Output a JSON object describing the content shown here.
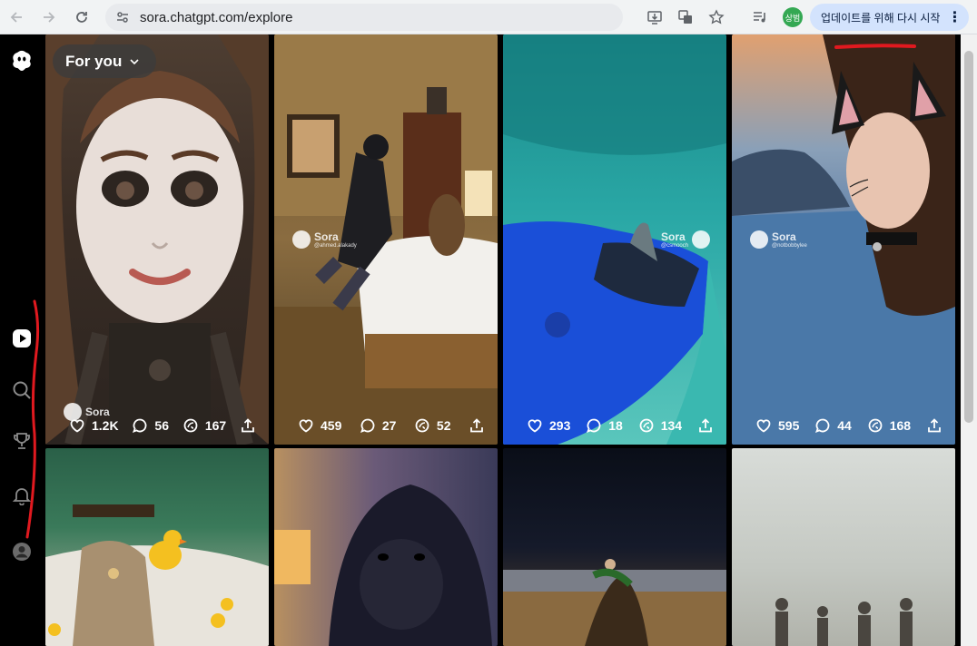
{
  "browser": {
    "url": "sora.chatgpt.com/explore",
    "profile_label": "상범",
    "update_label": "업데이트를 위해 다시 시작"
  },
  "feed": {
    "filter_label": "For you",
    "tiles": [
      {
        "likes": "1.2K",
        "comments": "56",
        "remixes": "167",
        "wm_name": "Sora",
        "wm_handle": ""
      },
      {
        "likes": "459",
        "comments": "27",
        "remixes": "52",
        "wm_name": "Sora",
        "wm_handle": "@ahmed.alakady"
      },
      {
        "likes": "293",
        "comments": "18",
        "remixes": "134",
        "wm_name": "Sora",
        "wm_handle": "@csmooch"
      },
      {
        "likes": "595",
        "comments": "44",
        "remixes": "168",
        "wm_name": "Sora",
        "wm_handle": "@notbobbylee"
      }
    ]
  },
  "colors": {
    "annotation": "#e0191f",
    "update_bg": "#d3e3fd"
  }
}
